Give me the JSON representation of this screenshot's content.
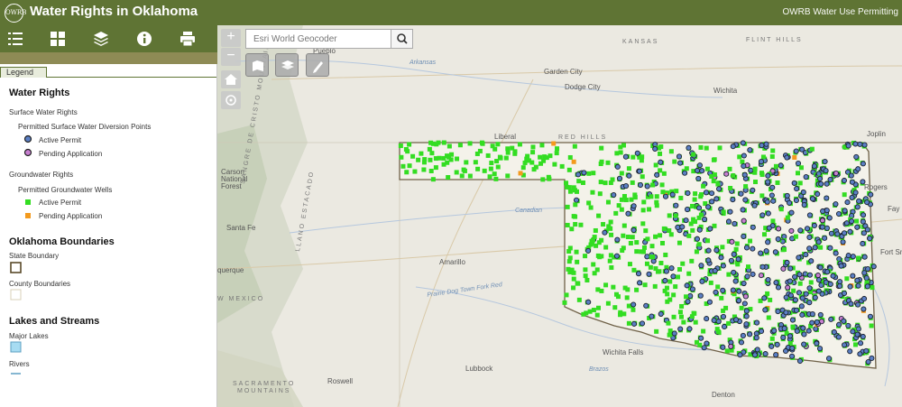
{
  "header": {
    "logo_text": "OWRB",
    "title": "Water Rights in Oklahoma",
    "subtitle": "OWRB Water Use Permitting"
  },
  "toolbar": {
    "icons": [
      "list-icon",
      "grid-icon",
      "layers-icon",
      "info-icon",
      "print-icon"
    ]
  },
  "legend": {
    "tab_label": "Legend",
    "water_rights": {
      "title": "Water Rights",
      "surface": {
        "heading": "Surface Water Rights",
        "layer": "Permitted Surface Water Diversion Points",
        "items": [
          {
            "label": "Active Permit",
            "color": "#5b7fc4"
          },
          {
            "label": "Pending Application",
            "color": "#c77fd0"
          }
        ]
      },
      "groundwater": {
        "heading": "Groundwater Rights",
        "layer": "Permitted Groundwater Wells",
        "items": [
          {
            "label": "Active Permit",
            "color": "#33dd22"
          },
          {
            "label": "Pending Application",
            "color": "#f39a1e"
          }
        ]
      }
    },
    "boundaries": {
      "title": "Oklahoma Boundaries",
      "state": "State Boundary",
      "county": "County Boundaries"
    },
    "lakes": {
      "title": "Lakes and Streams",
      "major_lakes": "Major Lakes",
      "rivers": "Rivers"
    }
  },
  "map": {
    "search_placeholder": "Esri World Geocoder",
    "zoom_in": "+",
    "zoom_out": "−",
    "labels": {
      "kansas": "KANSAS",
      "flint_hills": "FLINT HILLS",
      "red_hills": "RED HILLS",
      "pueblo": "Pueblo",
      "arkansas": "Arkansas",
      "garden_city": "Garden City",
      "dodge_city": "Dodge City",
      "wichita": "Wichita",
      "joplin": "Joplin",
      "liberal": "Liberal",
      "rogers": "Rogers",
      "fay": "Fay",
      "fort_smith": "Fort Sm",
      "carson": "Carson",
      "national": "National",
      "forest": "Forest",
      "santa_fe": "Santa Fe",
      "querque": "querque",
      "new_mexico": "W MEXICO",
      "sangre": "SANGRE DE CRISTO MOUNTAINS",
      "llano": "LLANO ESTACADO",
      "canadian": "Canadian",
      "amarillo": "Amarillo",
      "prairie_dog": "Prairie Dog Town Fork Red",
      "wichita_falls": "Wichita Falls",
      "brazos": "Brazos",
      "lubbock": "Lubbock",
      "roswell": "Roswell",
      "sacramento": "SACRAMENTO",
      "mountains": "MOUNTAINS",
      "denton": "Denton"
    }
  }
}
